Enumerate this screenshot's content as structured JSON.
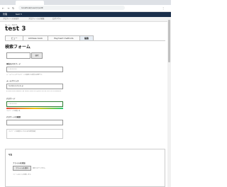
{
  "browser": {
    "tab_title": "検索フォーム",
    "url": "localhost/user/1/edit"
  },
  "toolbar": {
    "menu_label": "管理",
    "user_label": "test 3"
  },
  "secondary_tabs": [
    "プロフィールを表示",
    "プロフィールの編集",
    "ログアウト"
  ],
  "breadcrumb": "ホーム › test 3",
  "page_title": "test 3",
  "edit_tabs": [
    "ビュー",
    "Address book",
    "Payment methods",
    "編集"
  ],
  "search_heading": "検索フォーム",
  "search_button": "検索",
  "current_password": {
    "label": "現在のパスワード",
    "value": "••••••••",
    "desc": "メールアドレスやパスワードを変更する場合は必要です。"
  },
  "email": {
    "label": "メールアドレス",
    "value": "test@example.jp",
    "desc": "A valid email address. All emails from the system will be sent to this address."
  },
  "password": {
    "label": "パスワード",
    "value": "••••••••",
    "strength": "パスワードの強度: 強",
    "strength_level": 1.0
  },
  "confirm_password": {
    "label": "パスワードの確認",
    "suggestion": "パスワードの強度を上げるための推奨事項"
  },
  "details": {
    "summary": "写真",
    "file_label": "ファイルを追加",
    "choose_button": "ファイルを選択",
    "no_file": "選択されていません",
    "hint": "ファイルを1つに制限します。"
  }
}
